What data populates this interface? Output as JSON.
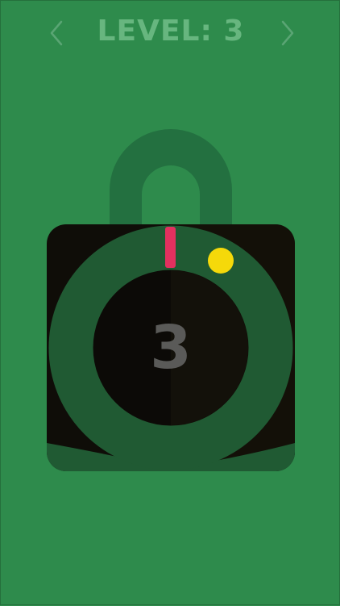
{
  "header": {
    "title": "LEVEL: 3",
    "prev_icon": "chevron-left-icon",
    "next_icon": "chevron-right-icon"
  },
  "lock": {
    "level_number": "3",
    "colors": {
      "background": "#2e8b4c",
      "shackle": "#237040",
      "body": "#0f0d08",
      "ring": "#205a33",
      "needle": "#e2305f",
      "target": "#f5d90a",
      "number": "#5a5a58",
      "title": "#67b67f"
    }
  }
}
